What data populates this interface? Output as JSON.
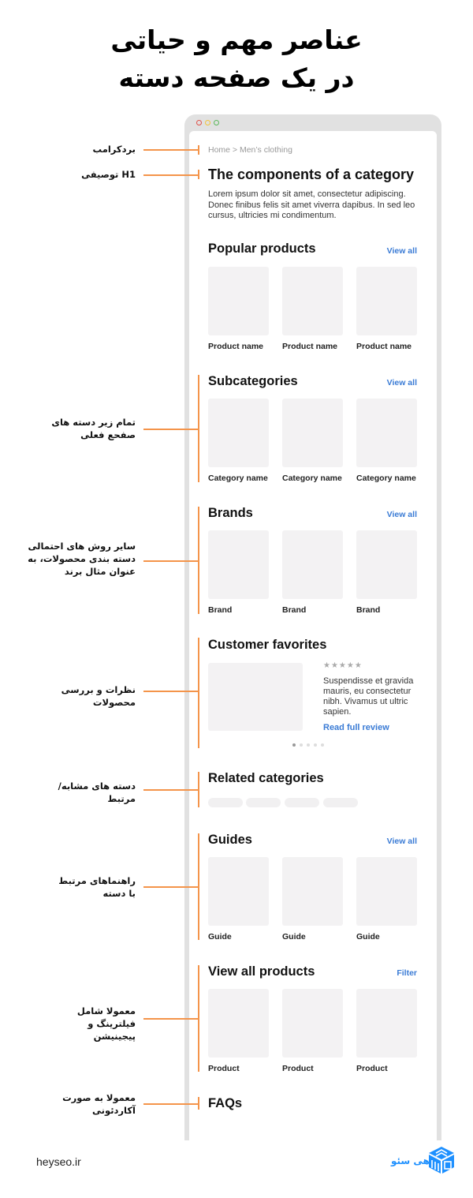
{
  "title": {
    "line1": "عناصر مهم و حیاتی",
    "line2": "در یک صفحه دسته"
  },
  "window": {
    "controls": [
      {
        "name": "close",
        "color": "#e0524a"
      },
      {
        "name": "minimize",
        "color": "#f2c23a"
      },
      {
        "name": "maximize",
        "color": "#5cb85c"
      }
    ]
  },
  "page": {
    "breadcrumb": "Home > Men’s clothing",
    "h1": "The components of a category",
    "lead": "Lorem ipsum dolor sit amet, consectetur adipiscing. Donec finibus felis sit amet viverra dapibus. In sed leo cursus, ultricies mi condimentum.",
    "sections": {
      "popular": {
        "title": "Popular products",
        "link": "View all",
        "items": [
          "Product name",
          "Product name",
          "Product name"
        ]
      },
      "subcategories": {
        "title": "Subcategories",
        "link": "View all",
        "items": [
          "Category name",
          "Category name",
          "Category name"
        ]
      },
      "brands": {
        "title": "Brands",
        "link": "View all",
        "items": [
          "Brand",
          "Brand",
          "Brand"
        ]
      },
      "favorites": {
        "title": "Customer favorites",
        "rating_stars": 5,
        "stars": "★★★★★",
        "review": "Suspendisse et gravida mauris, eu consectetur nibh. Vivamus ut ultric sapien.",
        "link": "Read full review",
        "carousel": {
          "total": 5,
          "active": 1
        }
      },
      "related": {
        "title": "Related categories",
        "chip_count": 4
      },
      "guides": {
        "title": "Guides",
        "link": "View all",
        "items": [
          "Guide",
          "Guide",
          "Guide"
        ]
      },
      "all_products": {
        "title": "View all products",
        "link": "Filter",
        "items": [
          "Product",
          "Product",
          "Product"
        ]
      },
      "faqs": {
        "title": "FAQs"
      }
    }
  },
  "annotations": {
    "breadcrumb": "بردکرامب",
    "h1": "H1 توصیفی",
    "subcategories": "تمام زیر دسته های صفحع فعلی",
    "brands": "سایر روش های احتمالی دسته بندی محصولات، به عنوان مثال برند",
    "favorites": "نظرات و بررسی محصولات",
    "related": "دسته های مشابه/مرتبط",
    "guides": "راهنماهای مرتبط با دسته",
    "all_products": "معمولا شامل فیلترینگ و پیجینیشن",
    "faqs": "معمولا به صورت آکاردئونی"
  },
  "footer": {
    "site": "heyseo.ir",
    "brand": "هی سئو"
  },
  "colors": {
    "accent_link": "#3a7bd5",
    "annotation_line": "#f4944a",
    "placeholder": "#f3f2f3",
    "frame": "#e1e1e1",
    "brand_blue": "#1e90ff"
  }
}
